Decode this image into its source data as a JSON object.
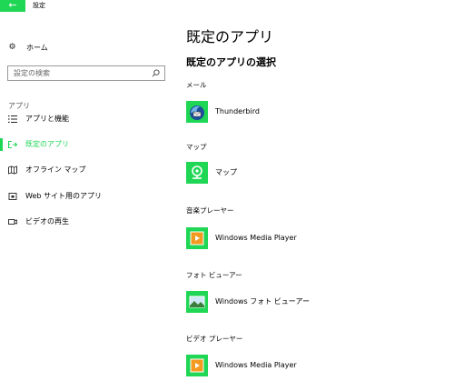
{
  "window": {
    "title": "設定"
  },
  "sidebar": {
    "home_label": "ホーム",
    "search_placeholder": "設定の検索",
    "section_header": "アプリ",
    "items": [
      {
        "label": "アプリと機能",
        "icon": "apps-list-icon",
        "active": false
      },
      {
        "label": "既定のアプリ",
        "icon": "default-apps-icon",
        "active": true
      },
      {
        "label": "オフライン マップ",
        "icon": "offline-map-icon",
        "active": false
      },
      {
        "label": "Web サイト用のアプリ",
        "icon": "website-apps-icon",
        "active": false
      },
      {
        "label": "ビデオの再生",
        "icon": "video-playback-icon",
        "active": false
      }
    ]
  },
  "main": {
    "title": "既定のアプリ",
    "subtitle": "既定のアプリの選択",
    "categories": [
      {
        "label": "メール",
        "app": "Thunderbird",
        "icon": "thunderbird-icon"
      },
      {
        "label": "マップ",
        "app": "マップ",
        "icon": "maps-icon"
      },
      {
        "label": "音楽プレーヤー",
        "app": "Windows Media Player",
        "icon": "media-player-icon"
      },
      {
        "label": "フォト ビューアー",
        "app": "Windows フォト ビューアー",
        "icon": "photo-viewer-icon"
      },
      {
        "label": "ビデオ プレーヤー",
        "app": "Windows Media Player",
        "icon": "media-player-icon"
      }
    ]
  },
  "colors": {
    "accent": "#1fd655"
  }
}
